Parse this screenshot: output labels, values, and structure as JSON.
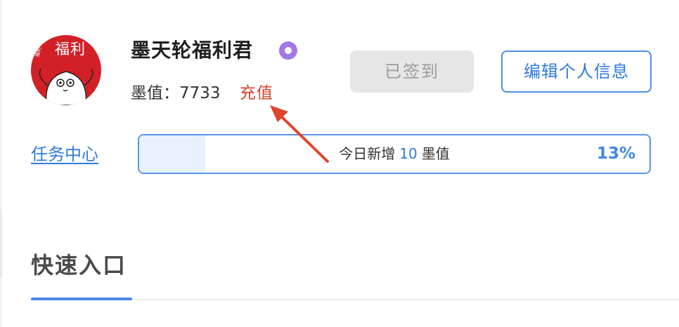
{
  "profile": {
    "avatar_text": "福利",
    "avatar_small_text": "福利",
    "username": "墨天轮福利君",
    "badge_icon": "gear-badge-icon",
    "points_label": "墨值：",
    "points_value": "7733",
    "recharge_label": "充值"
  },
  "actions": {
    "signed_in_label": "已签到",
    "edit_profile_label": "编辑个人信息"
  },
  "tasks": {
    "link_label": "任务中心",
    "progress_prefix": "今日新增",
    "progress_amount": "10",
    "progress_suffix": "墨值",
    "progress_percent_label": "13%",
    "progress_fraction": 0.13
  },
  "quick_entry": {
    "title": "快速入口"
  },
  "colors": {
    "accent": "#2f7be0",
    "recharge": "#d6422a",
    "badge": "#a178e6",
    "annotation_arrow": "#e0452b"
  }
}
